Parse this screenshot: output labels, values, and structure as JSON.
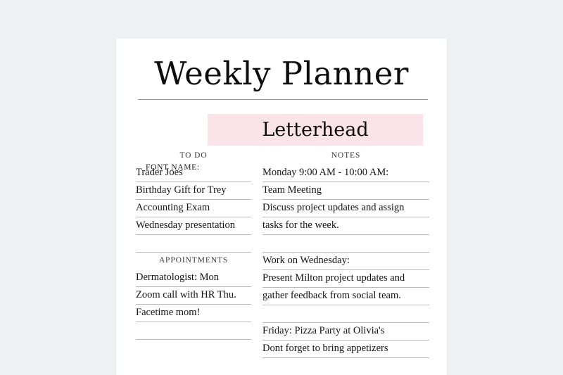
{
  "page": {
    "title": "Weekly Planner",
    "background_color": "#eef0f3",
    "sheet_color": "#ffffff",
    "rule_color": "#b9b9b9"
  },
  "font_name_row": {
    "label": "FONT NAME:",
    "value": "Letterhead",
    "highlight_color": "#fbe4e9"
  },
  "todo": {
    "heading": "TO DO",
    "items": [
      "Trader Joes",
      "Birthday Gift for Trey",
      "Accounting Exam",
      "Wednesday presentation",
      ""
    ]
  },
  "appointments": {
    "heading": "APPOINTMENTS",
    "items": [
      "Dermatologist: Mon",
      "Zoom call with HR Thu.",
      "Facetime mom!",
      ""
    ]
  },
  "notes": {
    "heading": "NOTES",
    "lines": [
      "Monday 9:00 AM - 10:00 AM:",
      "Team Meeting",
      "Discuss project updates and assign",
      "tasks for the week.",
      "",
      "Work on Wednesday:",
      "Present Milton project updates and",
      "gather feedback from social team.",
      "",
      "Friday: Pizza Party at Olivia's",
      "Dont forget to bring appetizers"
    ]
  }
}
